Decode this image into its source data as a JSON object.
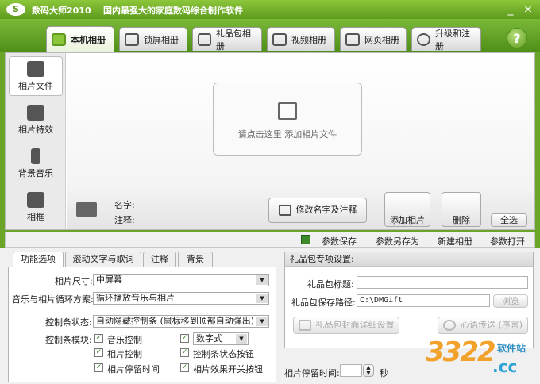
{
  "window": {
    "logo": "S",
    "title": "数码大师2010",
    "subtitle": "国内最强大的家庭数码综合制作软件",
    "minimize": "_",
    "close": "×"
  },
  "tabs": [
    {
      "label": "本机相册",
      "icon": "album-icon"
    },
    {
      "label": "锁屏相册",
      "icon": "monitor-icon"
    },
    {
      "label": "礼品包相册",
      "icon": "gift-icon"
    },
    {
      "label": "视频相册",
      "icon": "film-icon"
    },
    {
      "label": "网页相册",
      "icon": "browser-icon"
    },
    {
      "label": "升级和注册",
      "icon": "globe-icon"
    }
  ],
  "help": "?",
  "sidebar": {
    "items": [
      {
        "label": "相片文件",
        "icon": "camera-icon"
      },
      {
        "label": "相片特效",
        "icon": "effects-icon"
      },
      {
        "label": "背景音乐",
        "icon": "music-note-icon"
      },
      {
        "label": "相框",
        "icon": "frame-icon"
      }
    ]
  },
  "dropzone": {
    "text": "请点击这里  添加相片文件"
  },
  "info": {
    "name_label": "名字:",
    "note_label": "注释:",
    "edit_button": "修改名字及注释",
    "add_button": "添加相片",
    "delete_button": "删除",
    "select_all_button": "全选"
  },
  "toolbar": {
    "save": "参数保存",
    "save_as": "参数另存为",
    "new_album": "新建相册",
    "open": "参数打开"
  },
  "panel_tabs": [
    "功能选项",
    "滚动文字与歌词",
    "注释",
    "背景"
  ],
  "options": {
    "size_label": "相片尺寸:",
    "size_value": "中屏幕",
    "loop_label": "音乐与相片循环方案:",
    "loop_value": "循环播放音乐与相片",
    "bar_state_label": "控制条状态:",
    "bar_state_value": "自动隐藏控制条 (鼠标移到顶部自动弹出)",
    "bar_module_label": "控制条模块:",
    "checks": {
      "music": "音乐控制",
      "digital": "数字式",
      "photo": "相片控制",
      "bar_state_btn": "控制条状态按钮",
      "pause": "相片停留时间",
      "effect_switch": "相片效果开关按钮"
    }
  },
  "gift": {
    "title": "礼品包专项设置:",
    "name_label": "礼品包标题:",
    "name_value": "",
    "path_label": "礼品包保存路径:",
    "path_value": "C:\\DMGift",
    "browse": "浏览",
    "cover_button": "礼品包封面详细设置",
    "send_button": "心语传送 (序言)"
  },
  "pause": {
    "label": "相片停留时间:",
    "value": "",
    "unit": "秒"
  },
  "watermark": {
    "big": "3322",
    "cc": ".cc",
    "site": "软件站"
  }
}
